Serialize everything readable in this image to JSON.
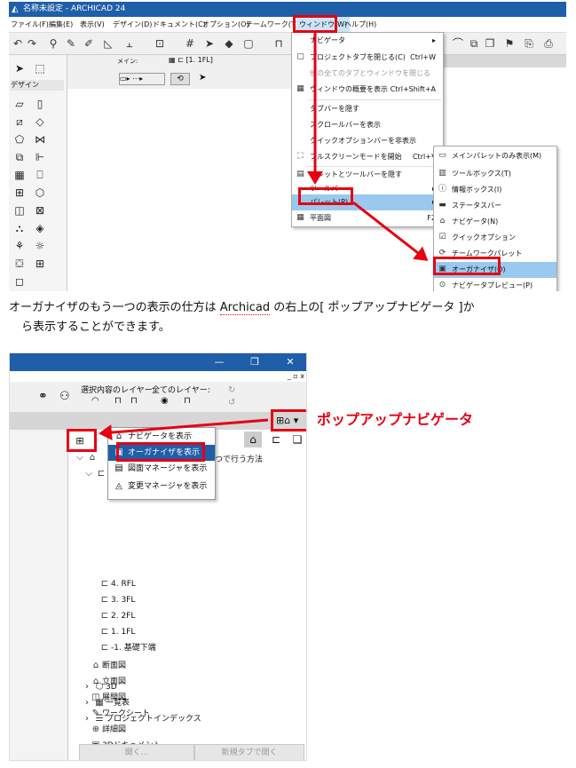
{
  "app": {
    "window_title": "名称未設定 - ARCHICAD 24",
    "menus": [
      "ファイル(F)",
      "編集(E)",
      "表示(V)",
      "デザイン(D)",
      "ドキュメント(C)",
      "オプション(O)",
      "チームワーク(T)",
      "ウィンドウ(W)",
      "ヘルプ(H)"
    ],
    "info_label": "メイン:",
    "design_label": "デザイン",
    "view_tab": "[1. 1FL]",
    "window_menu": {
      "items": [
        {
          "label": "ナビゲータ",
          "shortcut": "",
          "submenu": true
        },
        {
          "label": "プロジェクトタブを閉じる(C)",
          "shortcut": "Ctrl+W"
        },
        {
          "label": "他の全てのタブとウィンドウを閉じる",
          "shortcut": "",
          "disabled": true
        },
        {
          "label": "ウィンドウの概要を表示",
          "shortcut": "Ctrl+Shift+A"
        },
        {
          "label": "タブバーを隠す",
          "shortcut": ""
        },
        {
          "label": "スクロールバーを表示",
          "shortcut": ""
        },
        {
          "label": "クイックオプションバーを非表示",
          "shortcut": ""
        },
        {
          "label": "フルスクリーンモードを開始",
          "shortcut": "Ctrl+¥"
        },
        {
          "label": "パレットとツールバーを隠す",
          "shortcut": ""
        },
        {
          "label": "ツールバー",
          "shortcut": "",
          "submenu": true
        },
        {
          "label": "パレット(P)",
          "shortcut": "",
          "submenu": true
        },
        {
          "label": "平面図",
          "shortcut": "F2"
        }
      ]
    },
    "palette_menu": {
      "items": [
        {
          "label": "メインパレットのみ表示(M)"
        },
        {
          "label": "ツールボックス(T)"
        },
        {
          "label": "情報ボックス(I)"
        },
        {
          "label": "ステータスバー"
        },
        {
          "label": "ナビゲータ(N)"
        },
        {
          "label": "クイックオプション"
        },
        {
          "label": "チームワークパレット"
        },
        {
          "label": "オーガナイザ(O)"
        },
        {
          "label": "ナビゲータプレビュー(P)"
        }
      ]
    }
  },
  "paragraph": {
    "line1_before": "オーガナイザのもう一つの表示の仕方は ",
    "line1_brand": "Archicad",
    "line1_after": " の右上の[ ポップアップナビゲータ ]か",
    "line2": "ら表示することができます。"
  },
  "shot2": {
    "window_buttons": [
      "—",
      "❐",
      "✕"
    ],
    "subbar_buttons": "_ ▫ x",
    "layer_labels": [
      "選択内容のレイヤー:",
      "全てのレイヤー:"
    ],
    "popup_nav_label": "ポップアップナビゲータ",
    "pop_menu": [
      {
        "label": "ナビゲータを表示",
        "icon": "navigator-icon"
      },
      {
        "label": "オーガナイザを表示",
        "icon": "organizer-icon"
      },
      {
        "label": "図面マネージャを表示",
        "icon": "drawing-manager-icon"
      },
      {
        "label": "変更マネージャを表示",
        "icon": "change-manager-icon"
      }
    ],
    "tree_title_fragment": "一つで行う方法",
    "tree": [
      {
        "label": "4. RFL",
        "level": 2
      },
      {
        "label": "3. 3FL",
        "level": 2
      },
      {
        "label": "2. 2FL",
        "level": 2
      },
      {
        "label": "1. 1FL",
        "level": 2
      },
      {
        "label": "-1. 基礎下端",
        "level": 2
      },
      {
        "label": "断面図",
        "level": 1
      },
      {
        "label": "立面図",
        "level": 1
      },
      {
        "label": "展開図",
        "level": 1
      },
      {
        "label": "ワークシート",
        "level": 1
      },
      {
        "label": "詳細図",
        "level": 1
      },
      {
        "label": "3Dドキュメント",
        "level": 1
      },
      {
        "label": "3D",
        "level": 0
      },
      {
        "label": "一覧表",
        "level": 0
      },
      {
        "label": "プロジェクトインデックス",
        "level": 0
      }
    ],
    "buttons": [
      "開く...",
      "新規タブで開く"
    ]
  },
  "colors": {
    "highlight": "#e60012",
    "titlebar": "#1f5ea8",
    "menu_highlight": "#99c9ef"
  }
}
